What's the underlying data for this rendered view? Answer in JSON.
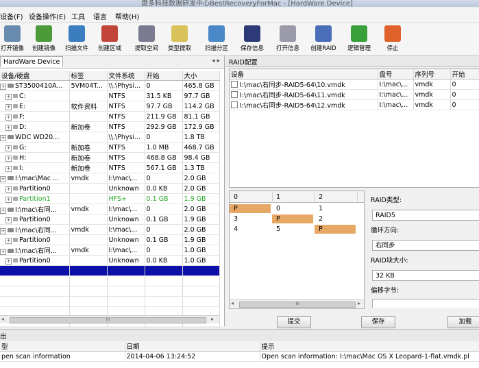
{
  "window": {
    "title": "盘多科技数据研发中心BestRecoveryForMac - [HardWare Device]"
  },
  "menu": [
    "设备(F)",
    "设备操作(E)",
    "工具",
    "语言",
    "帮助(H)"
  ],
  "toolbar": [
    {
      "label": "打开镜像",
      "icon": "disk-open-icon",
      "color": "#6a8bb0"
    },
    {
      "label": "创建镜像",
      "icon": "monitor-icon",
      "color": "#4c9a3a"
    },
    {
      "label": "扫描文件",
      "icon": "scan-icon",
      "color": "#3a7ec0"
    },
    {
      "label": "创建区域",
      "icon": "region-icon",
      "color": "#c2453a"
    },
    {
      "label": "提取空间",
      "icon": "extract-icon",
      "color": "#7a7a90"
    },
    {
      "label": "类型提取",
      "icon": "notepad-icon",
      "color": "#d9c25a"
    },
    {
      "label": "扫描分区",
      "icon": "partition-icon",
      "color": "#4a88c8"
    },
    {
      "label": "保存信息",
      "icon": "save-icon",
      "color": "#2c3a78"
    },
    {
      "label": "打开信息",
      "icon": "open-info-icon",
      "color": "#9a9aa8"
    },
    {
      "label": "创建RAID",
      "icon": "raid-icon",
      "color": "#4a6fb8"
    },
    {
      "label": "逻辑管理",
      "icon": "logic-icon",
      "color": "#39a03a"
    },
    {
      "label": "停止",
      "icon": "pause-icon",
      "color": "#e0622a"
    }
  ],
  "left": {
    "tab": "HardWare Device",
    "columns": [
      "设备/硬盘",
      "标签",
      "文件系统",
      "开始",
      "大小"
    ],
    "rows": [
      {
        "level": 0,
        "kind": "disk",
        "name": "ST3500410A...",
        "label": "5VM04T...",
        "fs": "\\\\.\\Physi...",
        "start": "0",
        "size": "465.8 GB"
      },
      {
        "level": 1,
        "kind": "part",
        "name": "C:",
        "label": "",
        "fs": "NTFS",
        "start": "31.5 KB",
        "size": "97.7 GB"
      },
      {
        "level": 1,
        "kind": "part",
        "name": "E:",
        "label": "软件资料",
        "fs": "NTFS",
        "start": "97.7 GB",
        "size": "114.2 GB"
      },
      {
        "level": 1,
        "kind": "part",
        "name": "F:",
        "label": "",
        "fs": "NTFS",
        "start": "211.9 GB",
        "size": "81.1 GB"
      },
      {
        "level": 1,
        "kind": "part",
        "name": "D:",
        "label": "新加卷",
        "fs": "NTFS",
        "start": "292.9 GB",
        "size": "172.9 GB"
      },
      {
        "level": 0,
        "kind": "disk",
        "name": "WDC WD20...",
        "label": "",
        "fs": "\\\\.\\Physi...",
        "start": "0",
        "size": "1.8 TB"
      },
      {
        "level": 1,
        "kind": "part",
        "name": "G:",
        "label": "新加卷",
        "fs": "NTFS",
        "start": "1.0 MB",
        "size": "468.7 GB"
      },
      {
        "level": 1,
        "kind": "part",
        "name": "H:",
        "label": "新加卷",
        "fs": "NTFS",
        "start": "468.8 GB",
        "size": "98.4 GB"
      },
      {
        "level": 1,
        "kind": "part",
        "name": "I:",
        "label": "新加卷",
        "fs": "NTFS",
        "start": "567.1 GB",
        "size": "1.3 TB"
      },
      {
        "level": 0,
        "kind": "disk",
        "name": "I:\\mac\\Mac ...",
        "label": "vmdk",
        "fs": "I:\\mac\\...",
        "start": "0",
        "size": "2.0 GB"
      },
      {
        "level": 1,
        "kind": "part",
        "name": "Partition0",
        "label": "",
        "fs": "Unknown",
        "start": "0.0 KB",
        "size": "2.0 GB"
      },
      {
        "level": 1,
        "kind": "part",
        "name": "Partition1",
        "label": "",
        "fs": "HFS+",
        "start": "0.1 GB",
        "size": "1.9 GB",
        "green": true
      },
      {
        "level": 0,
        "kind": "disk",
        "name": "I:\\mac\\右同...",
        "label": "vmdk",
        "fs": "I:\\mac\\...",
        "start": "0",
        "size": "2.0 GB"
      },
      {
        "level": 1,
        "kind": "part",
        "name": "Partition0",
        "label": "",
        "fs": "Unknown",
        "start": "0.1 GB",
        "size": "1.9 GB"
      },
      {
        "level": 0,
        "kind": "disk",
        "name": "I:\\mac\\右同...",
        "label": "vmdk",
        "fs": "I:\\mac\\...",
        "start": "0",
        "size": "2.0 GB"
      },
      {
        "level": 1,
        "kind": "part",
        "name": "Partition0",
        "label": "",
        "fs": "Unknown",
        "start": "0.1 GB",
        "size": "1.9 GB"
      },
      {
        "level": 0,
        "kind": "disk",
        "name": "I:\\mac\\右同...",
        "label": "vmdk",
        "fs": "I:\\mac\\...",
        "start": "0",
        "size": "1.0 GB"
      },
      {
        "level": 1,
        "kind": "part",
        "name": "Partition0",
        "label": "",
        "fs": "Unknown",
        "start": "0.0 KB",
        "size": "1.0 GB"
      }
    ]
  },
  "raid": {
    "title": "RAID配置",
    "dev_columns": [
      "设备",
      "盘号",
      "序列号",
      "开始"
    ],
    "devices": [
      {
        "path": "I:\\mac\\右同步-RAID5-64\\10.vmdk",
        "disk": "I:\\mac\\...",
        "serial": "vmdk",
        "start": "0"
      },
      {
        "path": "I:\\mac\\右同步-RAID5-64\\11.vmdk",
        "disk": "I:\\mac\\...",
        "serial": "vmdk",
        "start": "0"
      },
      {
        "path": "I:\\mac\\右同步-RAID5-64\\12.vmdk",
        "disk": "I:\\mac\\...",
        "serial": "vmdk",
        "start": "0"
      }
    ],
    "matrix_columns": [
      "0",
      "1",
      "2"
    ],
    "matrix": [
      [
        "P",
        "0",
        "1"
      ],
      [
        "3",
        "P",
        "2"
      ],
      [
        "4",
        "5",
        "P"
      ]
    ],
    "type_label": "RAID类型:",
    "type_value": "RAID5",
    "direction_label": "循环方向:",
    "direction_value": "右同步",
    "block_label": "RAID块大小:",
    "block_value": "32 KB",
    "offset_label": "偏移字节:",
    "submit": "提交",
    "save": "保存",
    "load": "加载"
  },
  "output": {
    "title": "出",
    "columns": [
      "型",
      "日期",
      "提示"
    ],
    "rows": [
      {
        "type": "pen scan information",
        "date": "2014-04-06 13:24:52",
        "msg": "Open scan information: I:\\mac\\Mac OS X Leopard-1-flat.vmdk.pl"
      }
    ]
  }
}
